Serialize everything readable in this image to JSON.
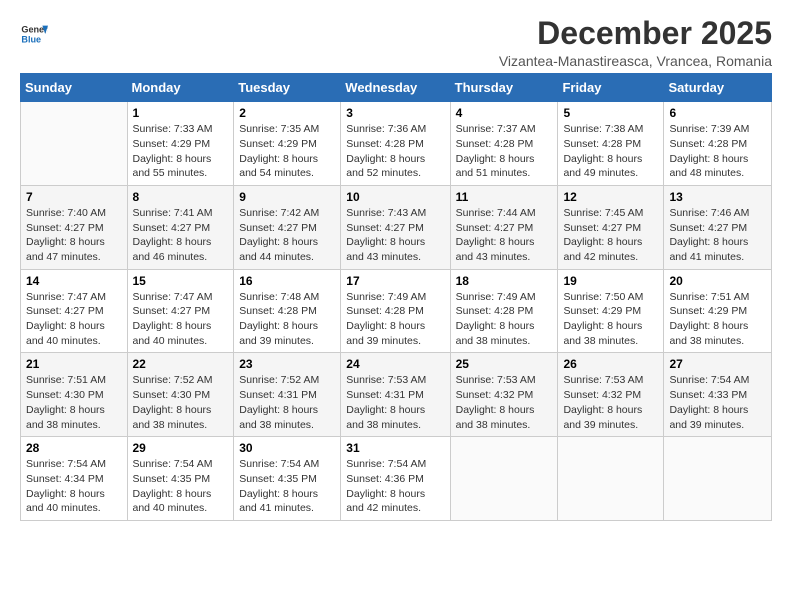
{
  "logo": {
    "general": "General",
    "blue": "Blue"
  },
  "title": "December 2025",
  "subtitle": "Vizantea-Manastireasca, Vrancea, Romania",
  "days_header": [
    "Sunday",
    "Monday",
    "Tuesday",
    "Wednesday",
    "Thursday",
    "Friday",
    "Saturday"
  ],
  "weeks": [
    [
      {
        "day": "",
        "info": ""
      },
      {
        "day": "1",
        "info": "Sunrise: 7:33 AM\nSunset: 4:29 PM\nDaylight: 8 hours\nand 55 minutes."
      },
      {
        "day": "2",
        "info": "Sunrise: 7:35 AM\nSunset: 4:29 PM\nDaylight: 8 hours\nand 54 minutes."
      },
      {
        "day": "3",
        "info": "Sunrise: 7:36 AM\nSunset: 4:28 PM\nDaylight: 8 hours\nand 52 minutes."
      },
      {
        "day": "4",
        "info": "Sunrise: 7:37 AM\nSunset: 4:28 PM\nDaylight: 8 hours\nand 51 minutes."
      },
      {
        "day": "5",
        "info": "Sunrise: 7:38 AM\nSunset: 4:28 PM\nDaylight: 8 hours\nand 49 minutes."
      },
      {
        "day": "6",
        "info": "Sunrise: 7:39 AM\nSunset: 4:28 PM\nDaylight: 8 hours\nand 48 minutes."
      }
    ],
    [
      {
        "day": "7",
        "info": "Sunrise: 7:40 AM\nSunset: 4:27 PM\nDaylight: 8 hours\nand 47 minutes."
      },
      {
        "day": "8",
        "info": "Sunrise: 7:41 AM\nSunset: 4:27 PM\nDaylight: 8 hours\nand 46 minutes."
      },
      {
        "day": "9",
        "info": "Sunrise: 7:42 AM\nSunset: 4:27 PM\nDaylight: 8 hours\nand 44 minutes."
      },
      {
        "day": "10",
        "info": "Sunrise: 7:43 AM\nSunset: 4:27 PM\nDaylight: 8 hours\nand 43 minutes."
      },
      {
        "day": "11",
        "info": "Sunrise: 7:44 AM\nSunset: 4:27 PM\nDaylight: 8 hours\nand 43 minutes."
      },
      {
        "day": "12",
        "info": "Sunrise: 7:45 AM\nSunset: 4:27 PM\nDaylight: 8 hours\nand 42 minutes."
      },
      {
        "day": "13",
        "info": "Sunrise: 7:46 AM\nSunset: 4:27 PM\nDaylight: 8 hours\nand 41 minutes."
      }
    ],
    [
      {
        "day": "14",
        "info": "Sunrise: 7:47 AM\nSunset: 4:27 PM\nDaylight: 8 hours\nand 40 minutes."
      },
      {
        "day": "15",
        "info": "Sunrise: 7:47 AM\nSunset: 4:27 PM\nDaylight: 8 hours\nand 40 minutes."
      },
      {
        "day": "16",
        "info": "Sunrise: 7:48 AM\nSunset: 4:28 PM\nDaylight: 8 hours\nand 39 minutes."
      },
      {
        "day": "17",
        "info": "Sunrise: 7:49 AM\nSunset: 4:28 PM\nDaylight: 8 hours\nand 39 minutes."
      },
      {
        "day": "18",
        "info": "Sunrise: 7:49 AM\nSunset: 4:28 PM\nDaylight: 8 hours\nand 38 minutes."
      },
      {
        "day": "19",
        "info": "Sunrise: 7:50 AM\nSunset: 4:29 PM\nDaylight: 8 hours\nand 38 minutes."
      },
      {
        "day": "20",
        "info": "Sunrise: 7:51 AM\nSunset: 4:29 PM\nDaylight: 8 hours\nand 38 minutes."
      }
    ],
    [
      {
        "day": "21",
        "info": "Sunrise: 7:51 AM\nSunset: 4:30 PM\nDaylight: 8 hours\nand 38 minutes."
      },
      {
        "day": "22",
        "info": "Sunrise: 7:52 AM\nSunset: 4:30 PM\nDaylight: 8 hours\nand 38 minutes."
      },
      {
        "day": "23",
        "info": "Sunrise: 7:52 AM\nSunset: 4:31 PM\nDaylight: 8 hours\nand 38 minutes."
      },
      {
        "day": "24",
        "info": "Sunrise: 7:53 AM\nSunset: 4:31 PM\nDaylight: 8 hours\nand 38 minutes."
      },
      {
        "day": "25",
        "info": "Sunrise: 7:53 AM\nSunset: 4:32 PM\nDaylight: 8 hours\nand 38 minutes."
      },
      {
        "day": "26",
        "info": "Sunrise: 7:53 AM\nSunset: 4:32 PM\nDaylight: 8 hours\nand 39 minutes."
      },
      {
        "day": "27",
        "info": "Sunrise: 7:54 AM\nSunset: 4:33 PM\nDaylight: 8 hours\nand 39 minutes."
      }
    ],
    [
      {
        "day": "28",
        "info": "Sunrise: 7:54 AM\nSunset: 4:34 PM\nDaylight: 8 hours\nand 40 minutes."
      },
      {
        "day": "29",
        "info": "Sunrise: 7:54 AM\nSunset: 4:35 PM\nDaylight: 8 hours\nand 40 minutes."
      },
      {
        "day": "30",
        "info": "Sunrise: 7:54 AM\nSunset: 4:35 PM\nDaylight: 8 hours\nand 41 minutes."
      },
      {
        "day": "31",
        "info": "Sunrise: 7:54 AM\nSunset: 4:36 PM\nDaylight: 8 hours\nand 42 minutes."
      },
      {
        "day": "",
        "info": ""
      },
      {
        "day": "",
        "info": ""
      },
      {
        "day": "",
        "info": ""
      }
    ]
  ]
}
